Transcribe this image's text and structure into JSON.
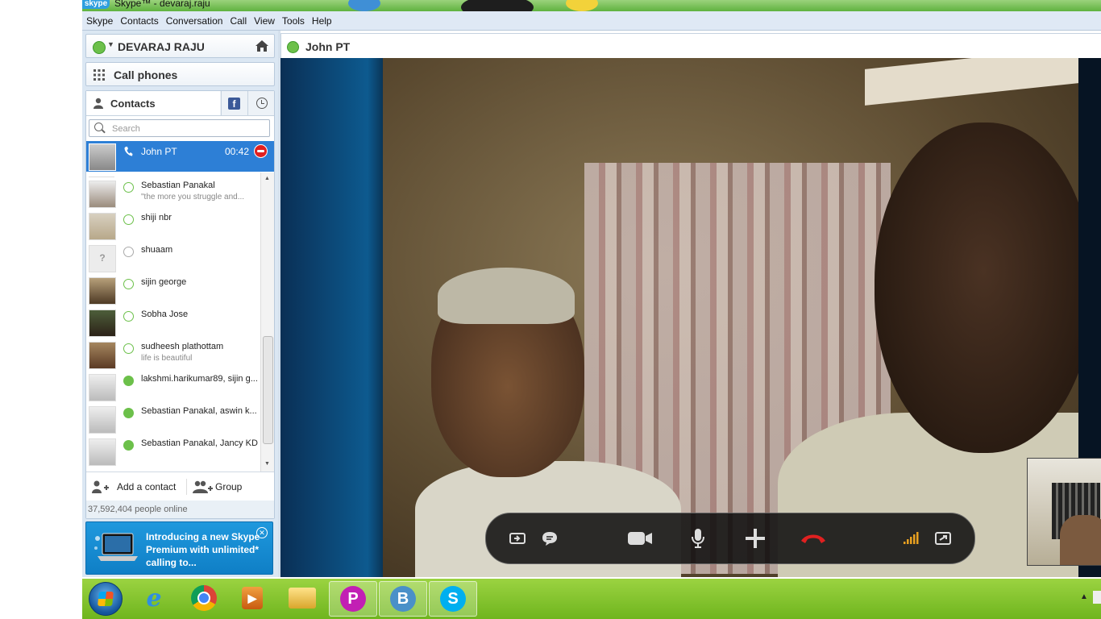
{
  "window": {
    "title": "Skype™ - devaraj.raju",
    "logo": "skype"
  },
  "menu": [
    "Skype",
    "Contacts",
    "Conversation",
    "Call",
    "View",
    "Tools",
    "Help"
  ],
  "user": {
    "name": "DEVARAJ RAJU",
    "status_icon": "online-status-icon"
  },
  "call_phones_label": "Call phones",
  "tabs": {
    "contacts": "Contacts",
    "facebook_icon": "facebook-icon",
    "recent_icon": "clock-icon"
  },
  "search": {
    "placeholder": "Search",
    "value": ""
  },
  "active_call": {
    "name": "John PT",
    "duration": "00:42"
  },
  "contacts": [
    {
      "name": "Sebastian Panakal",
      "mood": "\"the more you struggle and...",
      "status": "online"
    },
    {
      "name": "shiji nbr",
      "mood": "",
      "status": "online"
    },
    {
      "name": "shuaam",
      "mood": "",
      "status": "unknown"
    },
    {
      "name": "sijin george",
      "mood": "",
      "status": "online"
    },
    {
      "name": "Sobha Jose",
      "mood": "",
      "status": "online"
    },
    {
      "name": "sudheesh plathottam",
      "mood": "life is beautiful",
      "status": "online"
    },
    {
      "name": "lakshmi.harikumar89, sijin g...",
      "mood": "",
      "status": "group"
    },
    {
      "name": "Sebastian Panakal, aswin k...",
      "mood": "",
      "status": "group"
    },
    {
      "name": "Sebastian Panakal, Jancy KD",
      "mood": "",
      "status": "group"
    }
  ],
  "actions": {
    "add_contact": "Add a contact",
    "group": "Group"
  },
  "online_count": "37,592,404 people online",
  "promo": {
    "text": "Introducing a new Skype Premium with unlimited* calling to..."
  },
  "conversation": {
    "name": "John PT"
  },
  "call_controls": [
    "send-screen-icon",
    "chat-icon",
    "video-icon",
    "microphone-icon",
    "add-icon",
    "hang-up-icon",
    "signal-icon",
    "fullscreen-icon"
  ],
  "colors": {
    "accent_blue": "#2d7fd6",
    "online_green": "#6cc04a",
    "hangup_red": "#e02020",
    "taskbar_green": "#7cc12a"
  },
  "taskbar": [
    "windows-start-icon",
    "internet-explorer-icon",
    "chrome-icon",
    "media-player-icon",
    "file-explorer-icon",
    "p-app-icon",
    "b-app-icon",
    "skype-taskbar-icon"
  ]
}
